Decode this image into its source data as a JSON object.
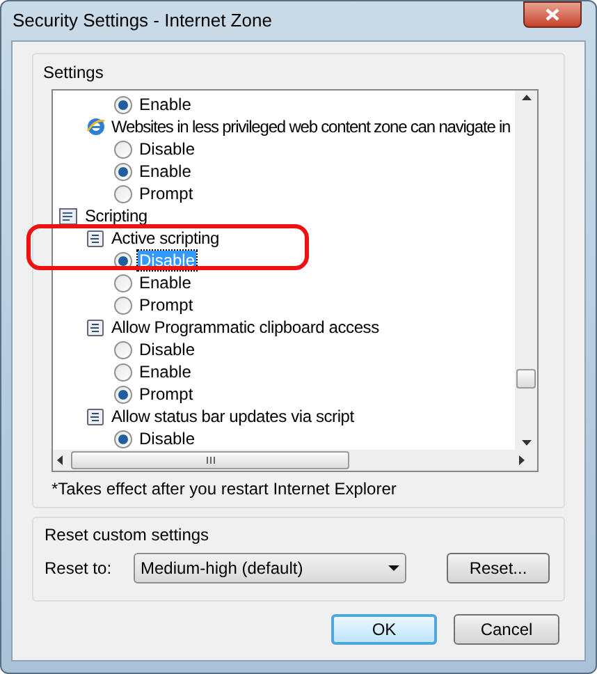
{
  "window": {
    "title": "Security Settings - Internet Zone"
  },
  "settings": {
    "label": "Settings",
    "items": [
      {
        "kind": "category",
        "children": [
          {
            "kind": "setting",
            "children": [
              {
                "kind": "option",
                "label": "Enable",
                "selected": true,
                "focused": false
              }
            ]
          },
          {
            "kind": "browser-setting",
            "label": "Websites in less privileged web content zone can navigate in",
            "children": [
              {
                "kind": "option",
                "label": "Disable",
                "selected": false,
                "focused": false
              },
              {
                "kind": "option",
                "label": "Enable",
                "selected": true,
                "focused": false
              },
              {
                "kind": "option",
                "label": "Prompt",
                "selected": false,
                "focused": false
              }
            ]
          }
        ]
      },
      {
        "kind": "category",
        "label": "Scripting",
        "children": [
          {
            "kind": "setting",
            "label": "Active scripting",
            "children": [
              {
                "kind": "option",
                "label": "Disable",
                "selected": true,
                "focused": true
              },
              {
                "kind": "option",
                "label": "Enable",
                "selected": false,
                "focused": false
              },
              {
                "kind": "option",
                "label": "Prompt",
                "selected": false,
                "focused": false
              }
            ]
          },
          {
            "kind": "setting",
            "label": "Allow Programmatic clipboard access",
            "children": [
              {
                "kind": "option",
                "label": "Disable",
                "selected": false,
                "focused": false
              },
              {
                "kind": "option",
                "label": "Enable",
                "selected": false,
                "focused": false
              },
              {
                "kind": "option",
                "label": "Prompt",
                "selected": true,
                "focused": false
              }
            ]
          },
          {
            "kind": "setting",
            "label": "Allow status bar updates via script",
            "children": [
              {
                "kind": "option",
                "label": "Disable",
                "selected": true,
                "focused": false
              }
            ]
          }
        ]
      }
    ],
    "note": "*Takes effect after you restart Internet Explorer"
  },
  "reset": {
    "label": "Reset custom settings",
    "field_label": "Reset to:",
    "value": "Medium-high (default)",
    "button": "Reset..."
  },
  "buttons": [
    {
      "label": "OK",
      "default": true
    },
    {
      "label": "Cancel",
      "default": false
    }
  ]
}
